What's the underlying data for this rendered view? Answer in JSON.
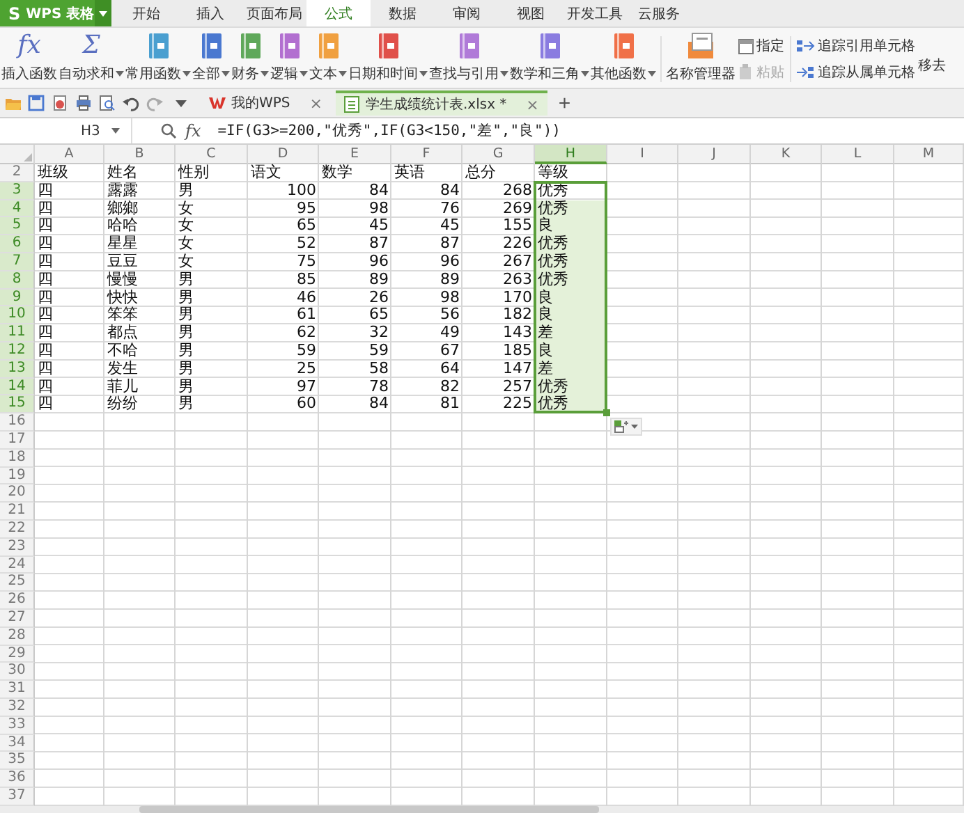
{
  "app_button": {
    "logo": "S",
    "label": "WPS 表格"
  },
  "menu_tabs": [
    {
      "label": "开始",
      "selected": false
    },
    {
      "label": "插入",
      "selected": false
    },
    {
      "label": "页面布局",
      "selected": false
    },
    {
      "label": "公式",
      "selected": true
    },
    {
      "label": "数据",
      "selected": false
    },
    {
      "label": "审阅",
      "selected": false
    },
    {
      "label": "视图",
      "selected": false
    },
    {
      "label": "开发工具",
      "selected": false
    },
    {
      "label": "云服务",
      "selected": false
    }
  ],
  "ribbon": {
    "functions": [
      {
        "kind": "glyph",
        "glyph": "fx",
        "label": "插入函数",
        "dropdown": false
      },
      {
        "kind": "glyph",
        "glyph": "Σ",
        "label": "自动求和",
        "dropdown": true
      },
      {
        "kind": "book",
        "color": "#4a9fd0",
        "label": "常用函数",
        "dropdown": true
      },
      {
        "kind": "book",
        "color": "#4a78d0",
        "label": "全部",
        "dropdown": true
      },
      {
        "kind": "book",
        "color": "#5fa85a",
        "label": "财务",
        "dropdown": true
      },
      {
        "kind": "book",
        "color": "#b26fd0",
        "label": "逻辑",
        "dropdown": true
      },
      {
        "kind": "book",
        "color": "#f0a040",
        "label": "文本",
        "dropdown": true
      },
      {
        "kind": "book",
        "color": "#e0504a",
        "label": "日期和时间",
        "dropdown": true
      },
      {
        "kind": "book",
        "color": "#b07ad8",
        "label": "查找与引用",
        "dropdown": true
      },
      {
        "kind": "book",
        "color": "#8a7ce0",
        "label": "数学和三角",
        "dropdown": true
      },
      {
        "kind": "book",
        "color": "#f07048",
        "label": "其他函数",
        "dropdown": true
      }
    ],
    "name_manager": {
      "label": "名称管理器"
    },
    "name_tools": [
      {
        "label": "指定",
        "disabled": false
      },
      {
        "label": "粘贴",
        "disabled": true
      }
    ],
    "trace_tools": [
      {
        "kind": "precedents",
        "label": "追踪引用单元格"
      },
      {
        "kind": "dependents",
        "label": "追踪从属单元格"
      }
    ],
    "cut_off_label": "移去"
  },
  "document_tabs": {
    "tabs": [
      {
        "kind": "home",
        "label": "我的WPS",
        "selected": false,
        "close": "×"
      },
      {
        "kind": "sheet",
        "label": "学生成绩统计表.xlsx *",
        "selected": true,
        "close": "×"
      }
    ],
    "new_tab": "+"
  },
  "formula_bar": {
    "name_box": "H3",
    "fx": "fx",
    "formula": "=IF(G3>=200,\"优秀\",IF(G3<150,\"差\",\"良\"))"
  },
  "sheet": {
    "columns": [
      {
        "label": "A",
        "selected": false,
        "kind": "text"
      },
      {
        "label": "B",
        "selected": false,
        "kind": "text"
      },
      {
        "label": "C",
        "selected": false,
        "kind": "text"
      },
      {
        "label": "D",
        "selected": false,
        "kind": "number"
      },
      {
        "label": "E",
        "selected": false,
        "kind": "number"
      },
      {
        "label": "F",
        "selected": false,
        "kind": "number"
      },
      {
        "label": "G",
        "selected": false,
        "kind": "number"
      },
      {
        "label": "H",
        "selected": true,
        "kind": "text"
      },
      {
        "label": "I",
        "selected": false,
        "kind": "text"
      },
      {
        "label": "J",
        "selected": false,
        "kind": "text"
      },
      {
        "label": "K",
        "selected": false,
        "kind": "text"
      },
      {
        "label": "L",
        "selected": false,
        "kind": "text"
      },
      {
        "label": "M",
        "selected": false,
        "kind": "text"
      }
    ],
    "rows": [
      {
        "number": "2",
        "kind": "header",
        "selected": false,
        "active": false,
        "cells": [
          "班级",
          "姓名",
          "性别",
          "语文",
          "数学",
          "英语",
          "总分",
          "等级"
        ]
      },
      {
        "number": "3",
        "kind": "record",
        "selected": true,
        "active": true,
        "cells": [
          "四",
          "露露",
          "男",
          "100",
          "84",
          "84",
          "268",
          "优秀"
        ]
      },
      {
        "number": "4",
        "kind": "record",
        "selected": true,
        "active": false,
        "cells": [
          "四",
          "鄉鄉",
          "女",
          "95",
          "98",
          "76",
          "269",
          "优秀"
        ]
      },
      {
        "number": "5",
        "kind": "record",
        "selected": true,
        "active": false,
        "cells": [
          "四",
          "哈哈",
          "女",
          "65",
          "45",
          "45",
          "155",
          "良"
        ]
      },
      {
        "number": "6",
        "kind": "record",
        "selected": true,
        "active": false,
        "cells": [
          "四",
          "星星",
          "女",
          "52",
          "87",
          "87",
          "226",
          "优秀"
        ]
      },
      {
        "number": "7",
        "kind": "record",
        "selected": true,
        "active": false,
        "cells": [
          "四",
          "豆豆",
          "女",
          "75",
          "96",
          "96",
          "267",
          "优秀"
        ]
      },
      {
        "number": "8",
        "kind": "record",
        "selected": true,
        "active": false,
        "cells": [
          "四",
          "慢慢",
          "男",
          "85",
          "89",
          "89",
          "263",
          "优秀"
        ]
      },
      {
        "number": "9",
        "kind": "record",
        "selected": true,
        "active": false,
        "cells": [
          "四",
          "快快",
          "男",
          "46",
          "26",
          "98",
          "170",
          "良"
        ]
      },
      {
        "number": "10",
        "kind": "record",
        "selected": true,
        "active": false,
        "cells": [
          "四",
          "笨笨",
          "男",
          "61",
          "65",
          "56",
          "182",
          "良"
        ]
      },
      {
        "number": "11",
        "kind": "record",
        "selected": true,
        "active": false,
        "cells": [
          "四",
          "都点",
          "男",
          "62",
          "32",
          "49",
          "143",
          "差"
        ]
      },
      {
        "number": "12",
        "kind": "record",
        "selected": true,
        "active": false,
        "cells": [
          "四",
          "不哈",
          "男",
          "59",
          "59",
          "67",
          "185",
          "良"
        ]
      },
      {
        "number": "13",
        "kind": "record",
        "selected": true,
        "active": false,
        "cells": [
          "四",
          "发生",
          "男",
          "25",
          "58",
          "64",
          "147",
          "差"
        ]
      },
      {
        "number": "14",
        "kind": "record",
        "selected": true,
        "active": false,
        "cells": [
          "四",
          "菲儿",
          "男",
          "97",
          "78",
          "82",
          "257",
          "优秀"
        ]
      },
      {
        "number": "15",
        "kind": "record",
        "selected": true,
        "active": false,
        "cells": [
          "四",
          "纷纷",
          "男",
          "60",
          "84",
          "81",
          "225",
          "优秀"
        ]
      },
      {
        "number": "16",
        "kind": "record",
        "selected": false,
        "active": false
      },
      {
        "number": "17",
        "kind": "record",
        "selected": false,
        "active": false
      },
      {
        "number": "18",
        "kind": "record",
        "selected": false,
        "active": false
      },
      {
        "number": "19",
        "kind": "record",
        "selected": false,
        "active": false
      },
      {
        "number": "20",
        "kind": "record",
        "selected": false,
        "active": false
      },
      {
        "number": "21",
        "kind": "record",
        "selected": false,
        "active": false
      },
      {
        "number": "22",
        "kind": "record",
        "selected": false,
        "active": false
      },
      {
        "number": "23",
        "kind": "record",
        "selected": false,
        "active": false
      },
      {
        "number": "24",
        "kind": "record",
        "selected": false,
        "active": false
      },
      {
        "number": "25",
        "kind": "record",
        "selected": false,
        "active": false
      },
      {
        "number": "26",
        "kind": "record",
        "selected": false,
        "active": false
      },
      {
        "number": "27",
        "kind": "record",
        "selected": false,
        "active": false
      },
      {
        "number": "28",
        "kind": "record",
        "selected": false,
        "active": false
      },
      {
        "number": "29",
        "kind": "record",
        "selected": false,
        "active": false
      },
      {
        "number": "30",
        "kind": "record",
        "selected": false,
        "active": false
      },
      {
        "number": "31",
        "kind": "record",
        "selected": false,
        "active": false
      },
      {
        "number": "32",
        "kind": "record",
        "selected": false,
        "active": false
      },
      {
        "number": "33",
        "kind": "record",
        "selected": false,
        "active": false
      },
      {
        "number": "34",
        "kind": "record",
        "selected": false,
        "active": false
      },
      {
        "number": "35",
        "kind": "record",
        "selected": false,
        "active": false
      },
      {
        "number": "36",
        "kind": "record",
        "selected": false,
        "active": false
      },
      {
        "number": "37",
        "kind": "record",
        "selected": false,
        "active": false
      }
    ]
  }
}
